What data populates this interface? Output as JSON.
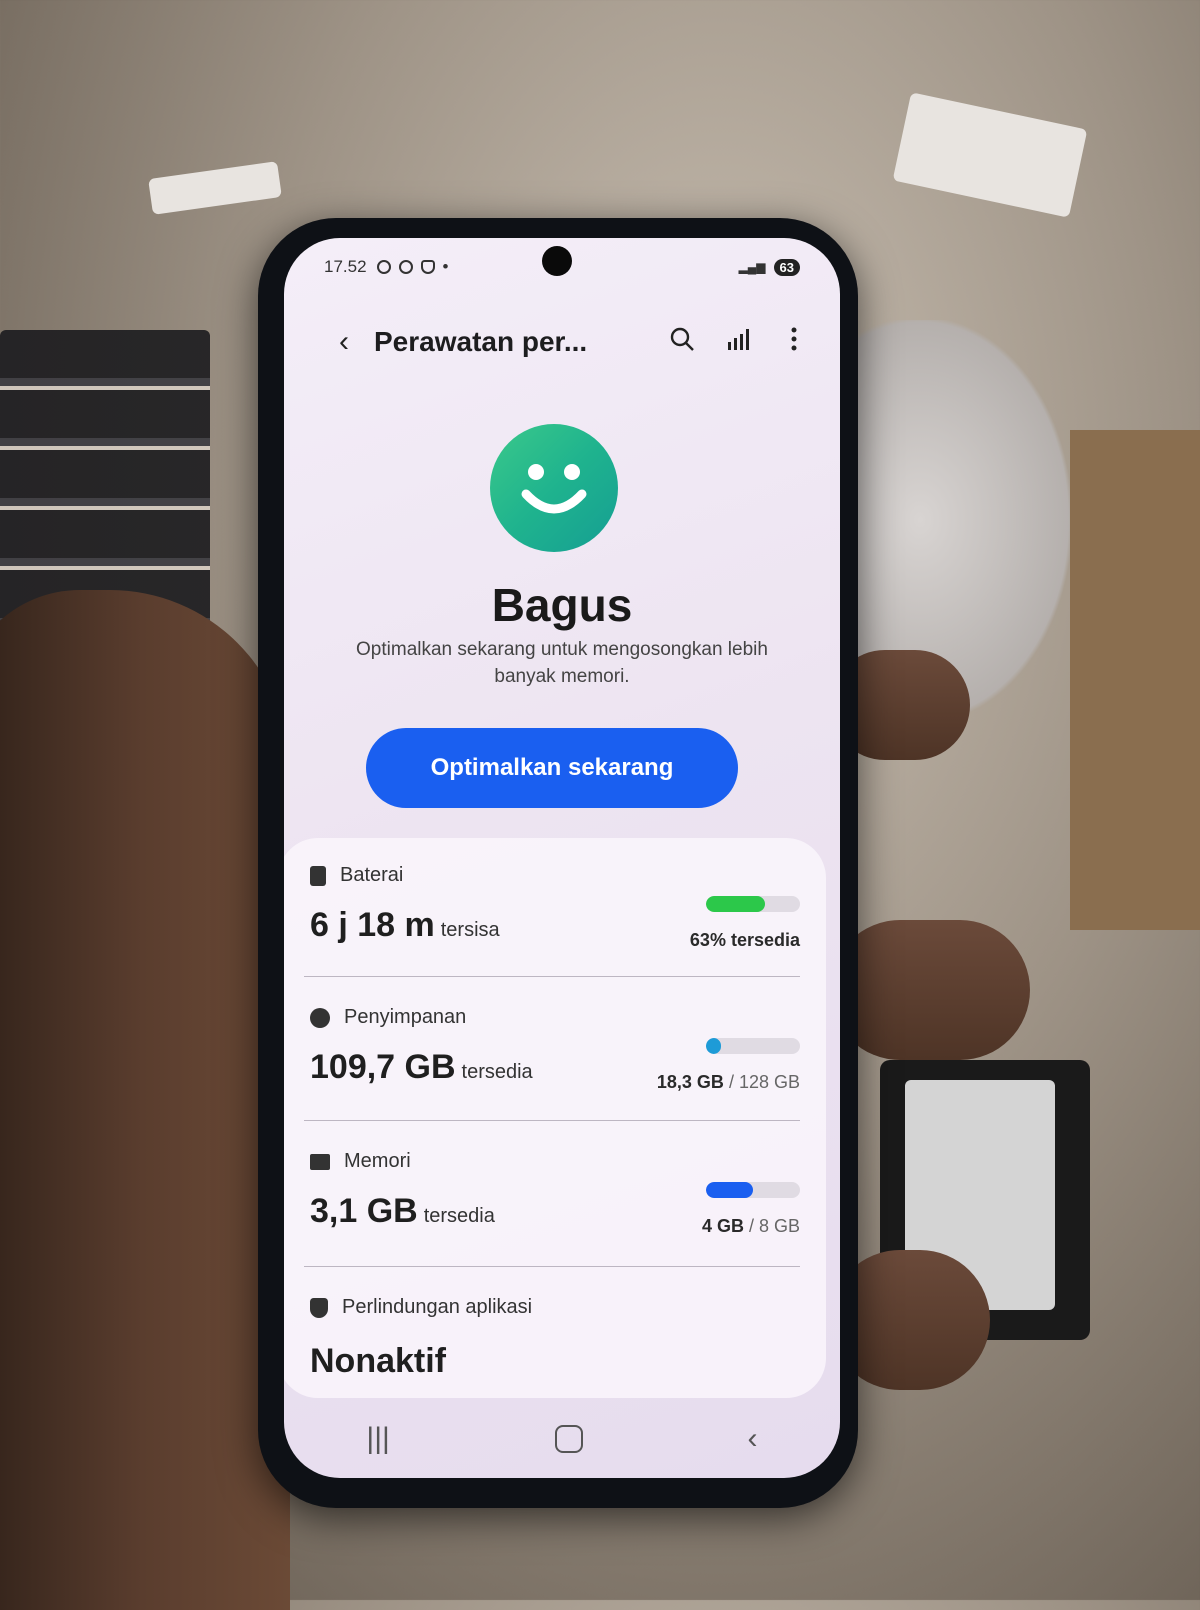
{
  "status_bar": {
    "time": "17.52",
    "battery": "63"
  },
  "app_bar": {
    "back_icon": "‹",
    "title": "Perawatan per...",
    "icons": [
      "search-icon",
      "stats-icon",
      "more-vert-icon"
    ]
  },
  "summary": {
    "status": "Bagus",
    "description": "Optimalkan sekarang untuk mengosongkan lebih banyak memori.",
    "button_label": "Optimalkan sekarang"
  },
  "battery": {
    "label": "Baterai",
    "value": "6 j 18 m",
    "suffix": "tersisa",
    "right_label": "63% tersedia",
    "fill_fraction": 0.63,
    "color": "#2cc84a"
  },
  "storage": {
    "label": "Penyimpanan",
    "value": "109,7 GB",
    "suffix": "tersedia",
    "used": "18,3 GB",
    "total": "/ 128 GB",
    "fill_fraction": 0.143,
    "color": "#1e9bd7"
  },
  "memory": {
    "label": "Memori",
    "value": "3,1 GB",
    "suffix": "tersedia",
    "used": "4 GB",
    "total": "/ 8 GB",
    "fill_fraction": 0.5,
    "color": "#1a5ff0"
  },
  "app_protection": {
    "label": "Perlindungan aplikasi",
    "value": "Nonaktif"
  },
  "colors": {
    "accent": "#1a5ff0",
    "smiley": "#1fb38e"
  }
}
